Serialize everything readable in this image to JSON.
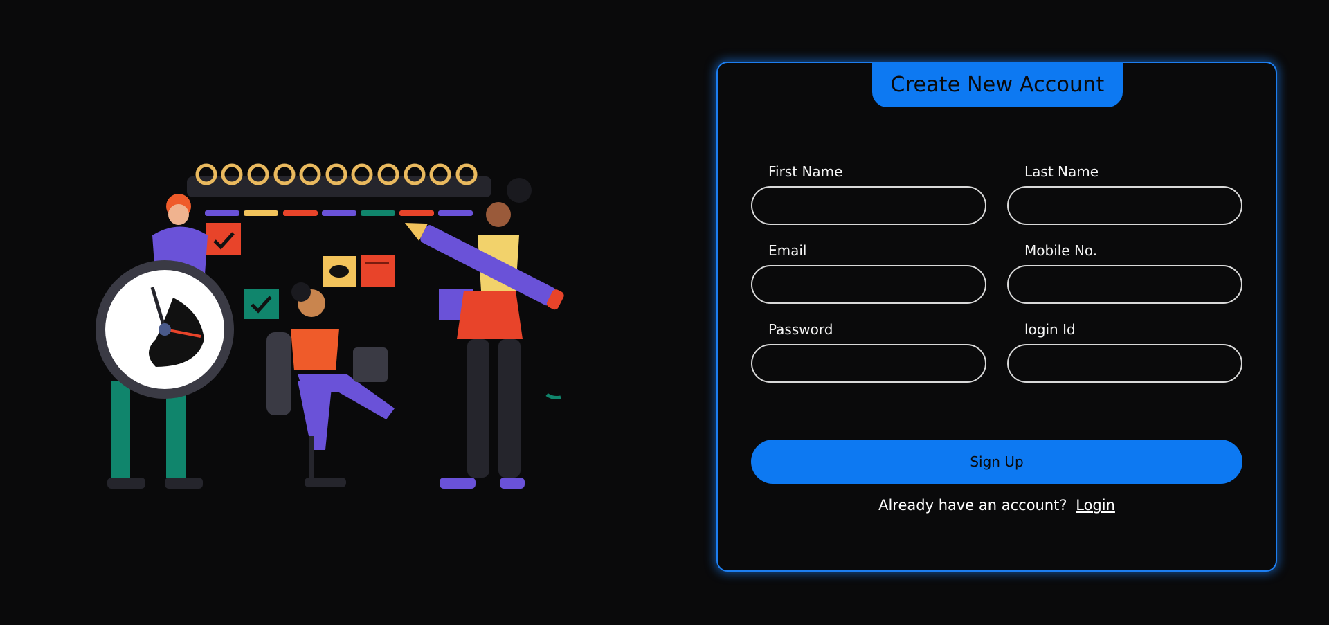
{
  "form": {
    "title": "Create New Account",
    "fields": [
      {
        "label": "First Name",
        "value": "",
        "placeholder": ""
      },
      {
        "label": "Last Name",
        "value": "",
        "placeholder": ""
      },
      {
        "label": "Email",
        "value": "",
        "placeholder": ""
      },
      {
        "label": "Mobile No.",
        "value": "",
        "placeholder": ""
      },
      {
        "label": "Password",
        "value": "",
        "placeholder": ""
      },
      {
        "label": "login Id",
        "value": "",
        "placeholder": ""
      }
    ],
    "submit_label": "Sign Up",
    "login_prompt": "Already have an account?",
    "login_link": "Login"
  },
  "colors": {
    "background": "#0a0a0b",
    "accent": "#0d79f2",
    "card_border": "#1d7ef0"
  }
}
